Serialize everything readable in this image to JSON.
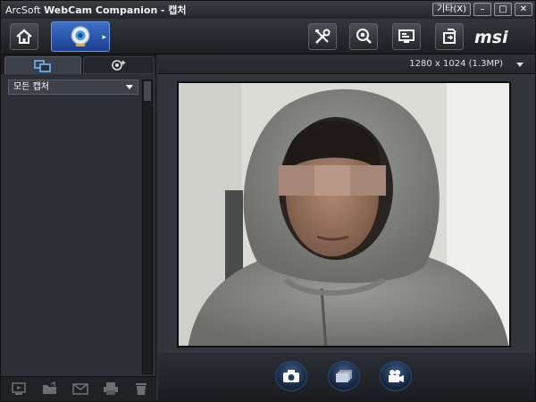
{
  "window": {
    "title_brand": "ArcSoft",
    "title_app": "WebCam Companion",
    "title_mode": "- 캡처",
    "more_label": "기타(X)",
    "minimize_label": "–",
    "maximize_label": "□",
    "close_label": "✕"
  },
  "toolbar": {
    "logo_text": "msi",
    "icons": [
      "home-icon",
      "webcam-icon",
      "tools-icon",
      "search-icon",
      "display-icon",
      "export-icon"
    ]
  },
  "left_panel": {
    "tabs": [
      "media-tab-icon",
      "effects-tab-icon"
    ],
    "filter_value": "모든 캡처",
    "bottom_icons": [
      "slideshow-icon",
      "open-folder-icon",
      "email-icon",
      "print-icon",
      "trash-icon"
    ]
  },
  "preview": {
    "resolution": "1280 x 1024 (1.3MP)"
  },
  "capture_controls": [
    "camera-icon",
    "burst-icon",
    "video-icon"
  ],
  "colors": {
    "accent": "#2f5fb7",
    "background": "#2a2d33"
  }
}
